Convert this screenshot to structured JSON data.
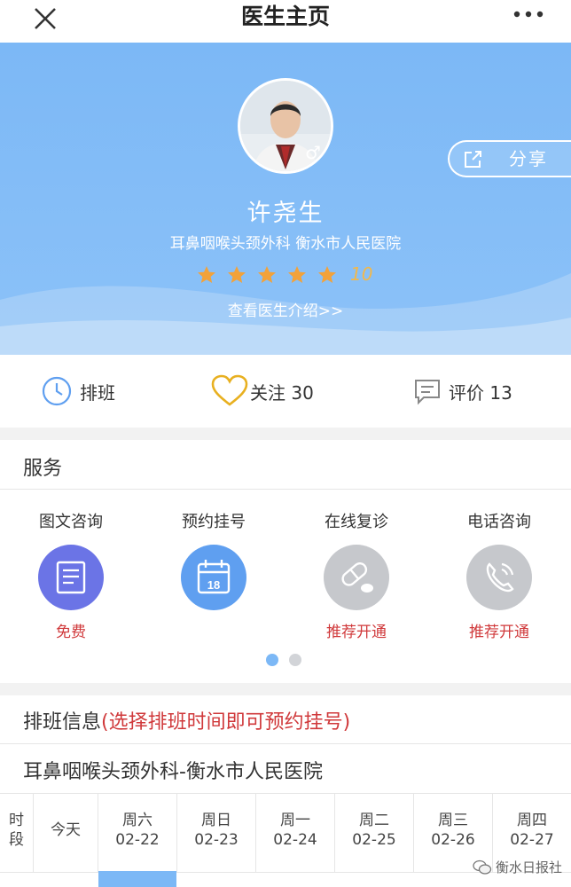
{
  "nav": {
    "title": "医生主页"
  },
  "profile": {
    "name": "许尧生",
    "department": "耳鼻咽喉头颈外科 衡水市人民医院",
    "gender_symbol": "♂",
    "star_count": 5,
    "score": "10",
    "intro_link": "查看医生介绍>>",
    "share_label": "分享"
  },
  "stats": {
    "schedule_label": "排班",
    "follow_label": "关注 30",
    "review_label": "评价 13"
  },
  "services": {
    "title": "服务",
    "items": [
      {
        "name": "图文咨询",
        "status": "免费",
        "icon": "document-icon",
        "color": "#6b74e6"
      },
      {
        "name": "预约挂号",
        "status": "",
        "icon": "calendar-icon",
        "color": "#5f9ff0"
      },
      {
        "name": "在线复诊",
        "status": "推荐开通",
        "icon": "pill-icon",
        "color": "#c6c8cc"
      },
      {
        "name": "电话咨询",
        "status": "推荐开通",
        "icon": "phone-icon",
        "color": "#c6c8cc"
      }
    ],
    "calendar_day": "18",
    "page_count": 2,
    "current_page": 1
  },
  "schedule": {
    "title": "排班信息",
    "hint": "(选择排班时间即可预约挂号)",
    "dept_line": "耳鼻咽喉头颈外科-衡水市人民医院",
    "period_header": "时\n段",
    "today_label": "今天",
    "days": [
      {
        "weekday": "周六",
        "date": "02-22"
      },
      {
        "weekday": "周日",
        "date": "02-23"
      },
      {
        "weekday": "周一",
        "date": "02-24"
      },
      {
        "weekday": "周二",
        "date": "02-25"
      },
      {
        "weekday": "周三",
        "date": "02-26"
      },
      {
        "weekday": "周四",
        "date": "02-27"
      }
    ]
  },
  "watermark": "衡水日报社",
  "colors": {
    "hero_blue": "#7cb8f6",
    "accent_red": "#d0393b",
    "star_orange": "#f2a23a",
    "heart_yellow": "#e8b020"
  }
}
